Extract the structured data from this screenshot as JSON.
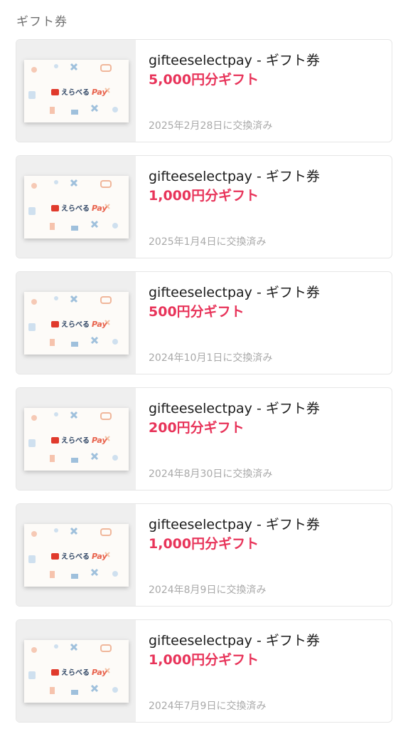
{
  "section_title": "ギフト券",
  "logo": {
    "text": "えらべる",
    "pay": "Pay"
  },
  "gifts": [
    {
      "title": "gifteeselectpay - ギフト券",
      "amount": "5,000円分ギフト",
      "date": "2025年2月28日に交換済み"
    },
    {
      "title": "gifteeselectpay - ギフト券",
      "amount": "1,000円分ギフト",
      "date": "2025年1月4日に交換済み"
    },
    {
      "title": "gifteeselectpay - ギフト券",
      "amount": "500円分ギフト",
      "date": "2024年10月1日に交換済み"
    },
    {
      "title": "gifteeselectpay - ギフト券",
      "amount": "200円分ギフト",
      "date": "2024年8月30日に交換済み"
    },
    {
      "title": "gifteeselectpay - ギフト券",
      "amount": "1,000円分ギフト",
      "date": "2024年8月9日に交換済み"
    },
    {
      "title": "gifteeselectpay - ギフト券",
      "amount": "1,000円分ギフト",
      "date": "2024年7月9日に交換済み"
    }
  ],
  "colors": {
    "amount": "#e8345a",
    "title": "#1c1c1c",
    "date": "#a9a9a9",
    "thumb_bg": "#efefef"
  }
}
